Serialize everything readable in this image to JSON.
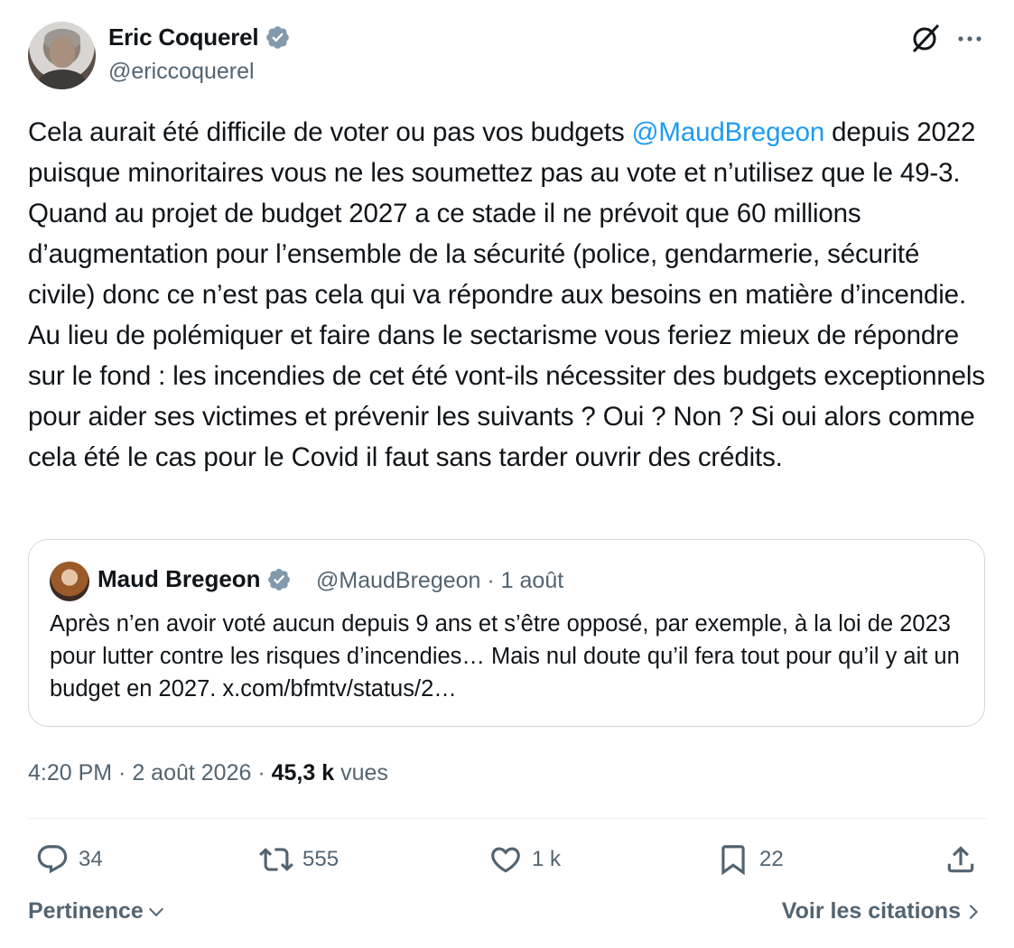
{
  "author": {
    "name": "Eric Coquerel",
    "handle": "@ericcoquerel"
  },
  "icons": {
    "verified": "verified-badge-icon",
    "grok": "grok-icon",
    "more": "more-icon",
    "reply": "reply-icon",
    "repost": "repost-icon",
    "like": "like-icon",
    "bookmark": "bookmark-icon",
    "share": "share-icon",
    "chevron_down": "chevron-down-icon",
    "chevron_right": "chevron-right-icon"
  },
  "colors": {
    "accent": "#1d9bf0",
    "text": "#0f1419",
    "muted": "#536471",
    "border": "#cfd9de"
  },
  "tweet": {
    "text_before_mention": "Cela aurait été difficile de voter ou pas vos budgets ",
    "mention": "@MaudBregeon",
    "text_after_mention": " depuis 2022 puisque minoritaires vous ne les soumettez pas au vote et n’utilisez que le 49-3. Quand au projet de budget 2027 a ce stade il ne prévoit que 60 millions d’augmentation pour l’ensemble de la sécurité (police, gendarmerie, sécurité civile) donc ce n’est pas cela qui va répondre aux besoins en matière d’incendie. Au lieu de polémiquer et faire dans le sectarisme vous feriez mieux de répondre sur le fond : les incendies de cet été vont-ils nécessiter des budgets exceptionnels pour aider ses victimes et prévenir les suivants ? Oui ? Non ? Si oui alors comme cela été le cas pour le Covid il faut sans tarder ouvrir des crédits."
  },
  "quote": {
    "name": "Maud Bregeon",
    "handle": "@MaudBregeon",
    "separator": "·",
    "date": "1 août",
    "text": "Après n’en avoir voté aucun depuis 9 ans et s’être opposé, par exemple, à la loi de 2023 pour lutter contre les risques d’incendies… Mais nul doute qu’il fera tout pour qu’il y ait un budget en 2027. x.com/bfmtv/status/2…"
  },
  "meta": {
    "time": "4:20 PM",
    "sep1": " · ",
    "date": "2 août 2026",
    "sep2": " · ",
    "views_count": "45,3 k",
    "views_label": "vues"
  },
  "actions": {
    "replies": "34",
    "reposts": "555",
    "likes": "1 k",
    "bookmarks": "22"
  },
  "footer": {
    "sort_label": "Pertinence",
    "quotes_link": "Voir les citations"
  }
}
